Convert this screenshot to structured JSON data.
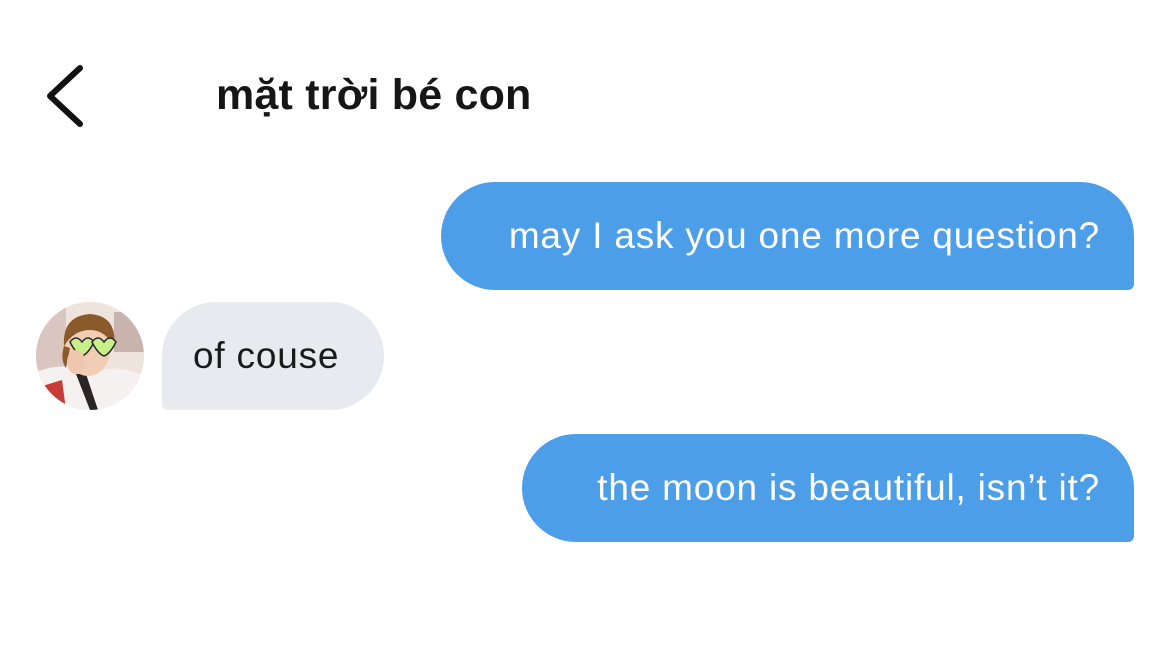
{
  "header": {
    "back_icon": "chevron-left-icon",
    "title": "mặt trời bé con"
  },
  "messages": [
    {
      "direction": "sent",
      "text": "may I ask you one more question?"
    },
    {
      "direction": "received",
      "text": "of couse"
    },
    {
      "direction": "sent",
      "text": "the moon is beautiful, isn’t it?"
    }
  ],
  "colors": {
    "sent_bubble": "#4d9ee9",
    "received_bubble": "#e7ebef",
    "title_text": "#161616",
    "background": "#ffffff"
  }
}
